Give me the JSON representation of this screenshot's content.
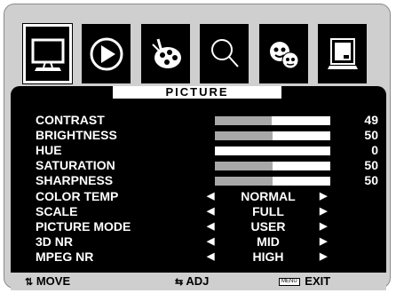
{
  "tabs": [
    {
      "name": "picture-tab",
      "icon": "monitor-icon"
    },
    {
      "name": "play-tab",
      "icon": "play-icon"
    },
    {
      "name": "palette-tab",
      "icon": "palette-icon"
    },
    {
      "name": "search-tab",
      "icon": "magnifier-icon"
    },
    {
      "name": "faces-tab",
      "icon": "faces-icon"
    },
    {
      "name": "display-tab",
      "icon": "display-icon"
    }
  ],
  "panel": {
    "title": "PICTURE",
    "sliders": [
      {
        "label": "CONTRAST",
        "value": "49",
        "level": 0.49
      },
      {
        "label": "BRIGHTNESS",
        "value": "50",
        "level": 0.5
      },
      {
        "label": "HUE",
        "value": "0",
        "level": 0.0
      },
      {
        "label": "SATURATION",
        "value": "50",
        "level": 0.5
      },
      {
        "label": "SHARPNESS",
        "value": "50",
        "level": 0.5
      }
    ],
    "options": [
      {
        "label": "COLOR TEMP",
        "value": "NORMAL"
      },
      {
        "label": "SCALE",
        "value": "FULL"
      },
      {
        "label": "PICTURE MODE",
        "value": "USER"
      },
      {
        "label": "3D NR",
        "value": "MID"
      },
      {
        "label": "MPEG NR",
        "value": "HIGH"
      }
    ]
  },
  "footer": {
    "move_symbol": "⇅",
    "move_label": "MOVE",
    "adj_symbol": "⇆",
    "adj_label": "ADJ",
    "menu_key": "MENU",
    "exit_label": "EXIT"
  },
  "colors": {
    "bar_fill": "#a8a8a8",
    "bar_bg": "#ffffff",
    "panel_bg": "#000000",
    "frame_bg": "#cfcfcf"
  }
}
